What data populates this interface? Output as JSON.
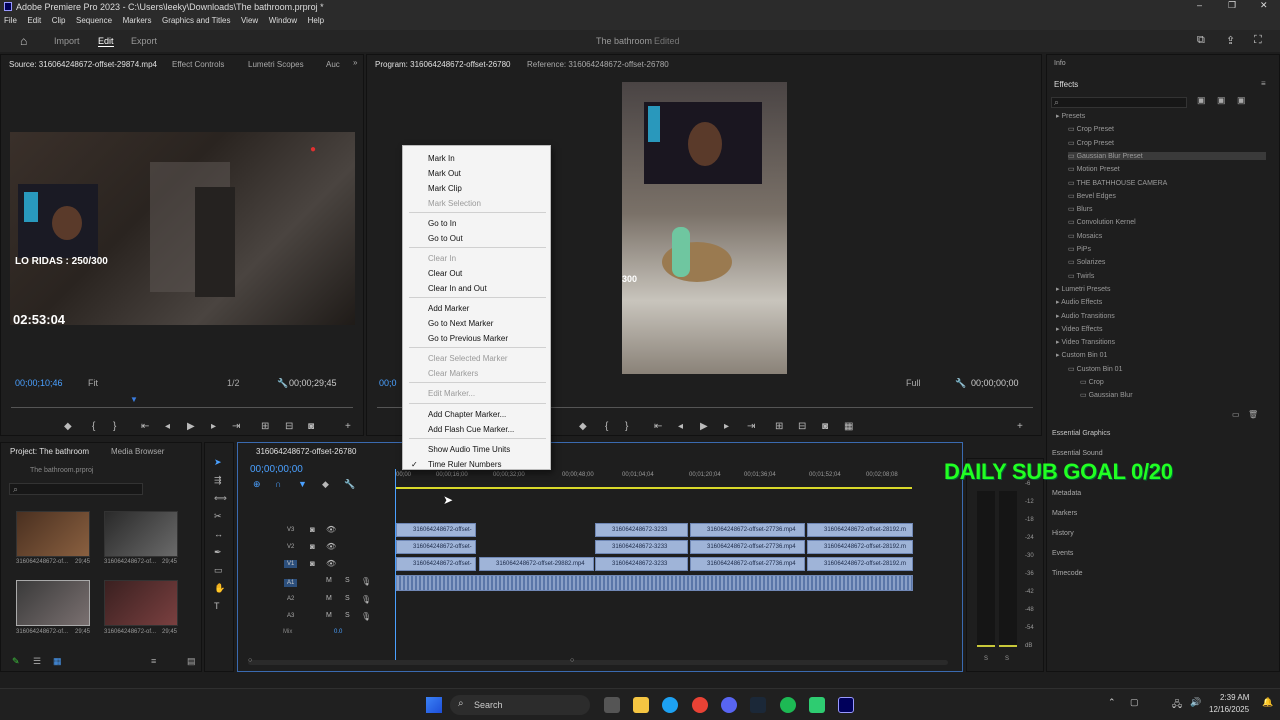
{
  "titlebar": {
    "title": "Adobe Premiere Pro 2023 - C:\\Users\\leeky\\Downloads\\The bathroom.prproj *"
  },
  "menu": [
    "File",
    "Edit",
    "Clip",
    "Sequence",
    "Markers",
    "Graphics and Titles",
    "View",
    "Window",
    "Help"
  ],
  "workspace": {
    "home_icon": "home-icon",
    "tabs": [
      "Import",
      "Edit",
      "Export"
    ],
    "active": "Edit",
    "project_title": "The bathroom",
    "project_status": "Edited"
  },
  "source": {
    "tabs": [
      "Source: 316064248672-offset-29874.mp4",
      "Effect Controls",
      "Lumetri Scopes",
      "Auc"
    ],
    "overlay_score": "LO RIDAS : 250/300",
    "overlay_time": "02:53:04",
    "timecode_in": "00;00;10;46",
    "fit": "Fit",
    "resolution": "1/2",
    "timecode_dur": "00;00;29;45"
  },
  "program": {
    "tab": "Program: 316064248672-offset-26780",
    "reference": "Reference: 316064248672-offset-26780",
    "timecode_in": "00;0",
    "fit": "Full",
    "timecode_dur": "00;00;00;00",
    "overlay_partial": "300"
  },
  "context_menu": [
    {
      "label": "Mark In",
      "enabled": true
    },
    {
      "label": "Mark Out",
      "enabled": true
    },
    {
      "label": "Mark Clip",
      "enabled": true
    },
    {
      "label": "Mark Selection",
      "enabled": false
    },
    {
      "label": "Go to In",
      "enabled": true
    },
    {
      "label": "Go to Out",
      "enabled": true
    },
    {
      "label": "Clear In",
      "enabled": false
    },
    {
      "label": "Clear Out",
      "enabled": true
    },
    {
      "label": "Clear In and Out",
      "enabled": true
    },
    {
      "label": "Add Marker",
      "enabled": true
    },
    {
      "label": "Go to Next Marker",
      "enabled": true
    },
    {
      "label": "Go to Previous Marker",
      "enabled": true
    },
    {
      "label": "Clear Selected Marker",
      "enabled": false
    },
    {
      "label": "Clear Markers",
      "enabled": false
    },
    {
      "label": "Edit Marker...",
      "enabled": false
    },
    {
      "label": "Add Chapter Marker...",
      "enabled": true
    },
    {
      "label": "Add Flash Cue Marker...",
      "enabled": true
    },
    {
      "label": "Show Audio Time Units",
      "enabled": true
    },
    {
      "label": "Time Ruler Numbers",
      "enabled": true,
      "checked": true
    }
  ],
  "project": {
    "tabs": [
      "Project: The bathroom",
      "Media Browser"
    ],
    "file": "The bathroom.prproj",
    "items": [
      {
        "name": "316064248672-of...",
        "dur": "29;45"
      },
      {
        "name": "316064248672-of...",
        "dur": "29;45"
      },
      {
        "name": "316064248672-of...",
        "dur": "29;45"
      },
      {
        "name": "316064248672-of...",
        "dur": "29;45"
      }
    ]
  },
  "timeline": {
    "tab": "316064248672-offset-26780",
    "timecode": "00;00;00;00",
    "ruler": [
      "00;00",
      "00;00;16;00",
      "00;00;32;00",
      "00;00;48;00",
      "00;01;04;04",
      "00;01;20;04",
      "00;01;36;04",
      "00;01;52;04",
      "00;02;08;08"
    ],
    "tracks": [
      "V3",
      "V2",
      "V1",
      "A1",
      "A2",
      "A3"
    ],
    "mix_label": "Mix",
    "mix_value": "0.0",
    "clips": [
      "316064248672-offset-",
      "316064248672-offset-",
      "316064248672-offset-",
      "316064248672-offset-29882.mp4",
      "316064248672-3233",
      "316064248672-3233",
      "316064248672-3233",
      "316064248672-offset-27736.mp4",
      "316064248672-offset-27736.mp4",
      "316064248672-offset-27736.mp4",
      "316064248672-offset-28192.m",
      "316064248672-offset-28192.m",
      "316064248672-offset-28192.m"
    ]
  },
  "overlay_goal": "DAILY SUB GOAL 0/20",
  "meter_scale": [
    "-6",
    "-12",
    "-18",
    "-24",
    "-30",
    "-36",
    "-42",
    "-48",
    "-54",
    "dB"
  ],
  "meter_solo": [
    "S",
    "S"
  ],
  "effects": {
    "info_tab": "Info",
    "title": "Effects",
    "tree": [
      {
        "label": "Presets",
        "level": 0
      },
      {
        "label": "Crop Preset",
        "level": 1
      },
      {
        "label": "Crop Preset",
        "level": 1
      },
      {
        "label": "Gaussian Blur Preset",
        "level": 1,
        "selected": true
      },
      {
        "label": "Motion Preset",
        "level": 1
      },
      {
        "label": "THE BATHHOUSE CAMERA",
        "level": 1
      },
      {
        "label": "Bevel Edges",
        "level": 1
      },
      {
        "label": "Blurs",
        "level": 1
      },
      {
        "label": "Convolution Kernel",
        "level": 1
      },
      {
        "label": "Mosaics",
        "level": 1
      },
      {
        "label": "PiPs",
        "level": 1
      },
      {
        "label": "Solarizes",
        "level": 1
      },
      {
        "label": "Twirls",
        "level": 1
      },
      {
        "label": "Lumetri Presets",
        "level": 0
      },
      {
        "label": "Audio Effects",
        "level": 0
      },
      {
        "label": "Audio Transitions",
        "level": 0
      },
      {
        "label": "Video Effects",
        "level": 0
      },
      {
        "label": "Video Transitions",
        "level": 0
      },
      {
        "label": "Custom Bin 01",
        "level": 0
      },
      {
        "label": "Custom Bin 01",
        "level": 1
      },
      {
        "label": "Crop",
        "level": 2
      },
      {
        "label": "Gaussian Blur",
        "level": 2
      }
    ],
    "panels": [
      "Essential Graphics",
      "Essential Sound",
      "Metadata",
      "Markers",
      "History",
      "Events",
      "Timecode"
    ]
  },
  "taskbar": {
    "search": "Search",
    "time": "2:39 AM",
    "date": "12/16/2025"
  }
}
